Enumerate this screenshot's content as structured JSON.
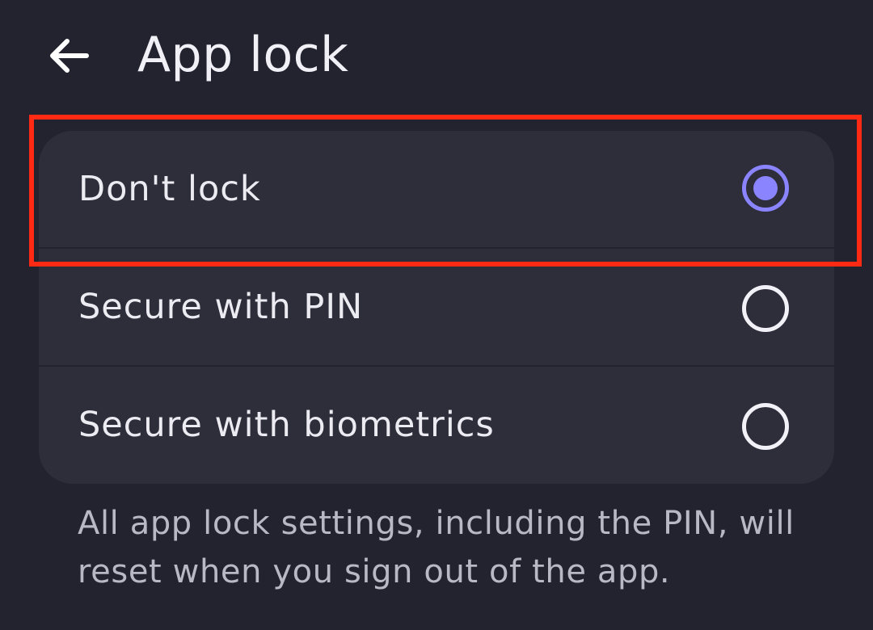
{
  "header": {
    "back_icon": "arrow-left-icon",
    "title": "App lock"
  },
  "lock_options": [
    {
      "label": "Don't lock",
      "selected": true
    },
    {
      "label": "Secure with PIN",
      "selected": false
    },
    {
      "label": "Secure with biometrics",
      "selected": false
    }
  ],
  "footnote": "All app lock settings, including the PIN, will reset when you sign out of the app.",
  "colors": {
    "background": "#23222f",
    "card": "#2e2d3a",
    "accent": "#8a85ff",
    "highlight_border": "#ff2a14",
    "text": "#ecebf2",
    "secondary_text": "#b9b8c5"
  }
}
